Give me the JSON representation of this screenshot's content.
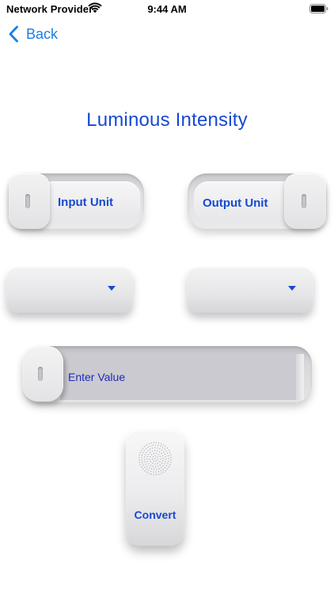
{
  "status_bar": {
    "carrier": "Network Provider",
    "time": "9:44 AM",
    "icons": [
      "wifi-icon",
      "battery-icon"
    ]
  },
  "nav": {
    "back_label": "Back",
    "back_icon": "chevron-left-icon"
  },
  "title": "Luminous Intensity",
  "input_unit": {
    "label": "Input Unit",
    "selected_value": ""
  },
  "output_unit": {
    "label": "Output Unit",
    "selected_value": ""
  },
  "value_field": {
    "placeholder": "Enter Value",
    "value": ""
  },
  "convert": {
    "label": "Convert",
    "icon": "speaker-grille-icon"
  },
  "colors": {
    "accent": "#1649d3",
    "back_link": "#1f7ce5",
    "field_text": "#1d2bb8",
    "field_bg": "#cbcad0"
  }
}
